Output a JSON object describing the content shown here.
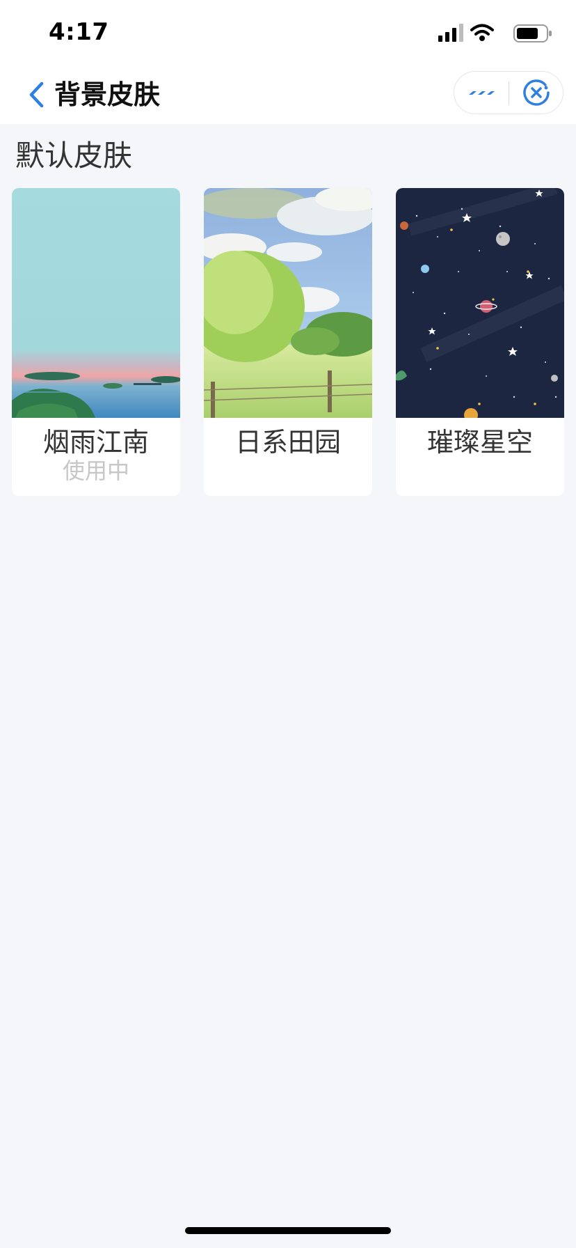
{
  "status_bar": {
    "time": "4:17"
  },
  "nav": {
    "title": "背景皮肤",
    "accent_color": "#2f7fe3"
  },
  "section": {
    "title": "默认皮肤"
  },
  "skins": [
    {
      "name": "烟雨江南",
      "status": "使用中"
    },
    {
      "name": "日系田园",
      "status": ""
    },
    {
      "name": "璀璨星空",
      "status": ""
    }
  ],
  "icons": {
    "back": "chevron-left-icon",
    "more": "more-dots-icon",
    "close": "close-circle-icon",
    "signal": "cellular-signal-icon",
    "wifi": "wifi-icon",
    "battery": "battery-icon"
  }
}
